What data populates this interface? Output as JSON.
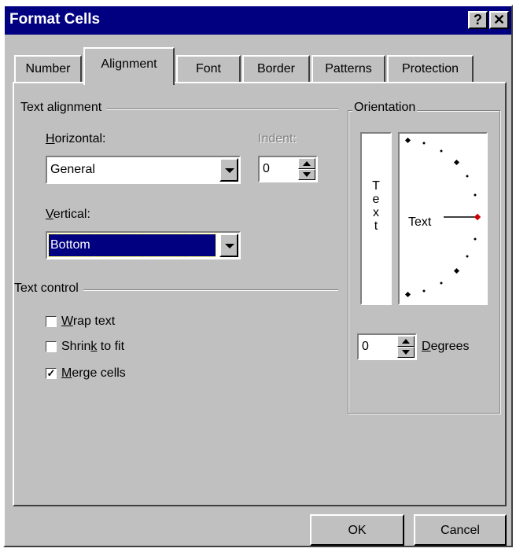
{
  "dialog": {
    "title": "Format Cells",
    "help_button": "?",
    "close_button": "✕"
  },
  "tabs": [
    {
      "label": "Number"
    },
    {
      "label": "Alignment"
    },
    {
      "label": "Font"
    },
    {
      "label": "Border"
    },
    {
      "label": "Patterns"
    },
    {
      "label": "Protection"
    }
  ],
  "text_alignment": {
    "group_label": "Text alignment",
    "horizontal_label_u": "H",
    "horizontal_label_rest": "orizontal:",
    "horizontal_value": "General",
    "indent_label": "Indent:",
    "indent_value": "0",
    "vertical_label_u": "V",
    "vertical_label_rest": "ertical:",
    "vertical_value": "Bottom"
  },
  "text_control": {
    "group_label": "Text control",
    "wrap_text": {
      "pre": "",
      "u": "W",
      "post": "rap text",
      "checked": false
    },
    "shrink_to_fit": {
      "pre": "Shrin",
      "u": "k",
      "post": " to fit",
      "checked": false
    },
    "merge_cells": {
      "pre": "",
      "u": "M",
      "post": "erge cells",
      "checked": true
    }
  },
  "orientation": {
    "group_label": "Orientation",
    "vertical_text": [
      "T",
      "e",
      "x",
      "t"
    ],
    "dial_text": "Text",
    "degrees_value": "0",
    "degrees_label_u": "D",
    "degrees_label_rest": "egrees"
  },
  "buttons": {
    "ok": "OK",
    "cancel": "Cancel"
  },
  "colors": {
    "title_bar": "#000080",
    "face": "#c0c0c0",
    "selection": "#000080",
    "dial_indicator": "#cc0000"
  }
}
